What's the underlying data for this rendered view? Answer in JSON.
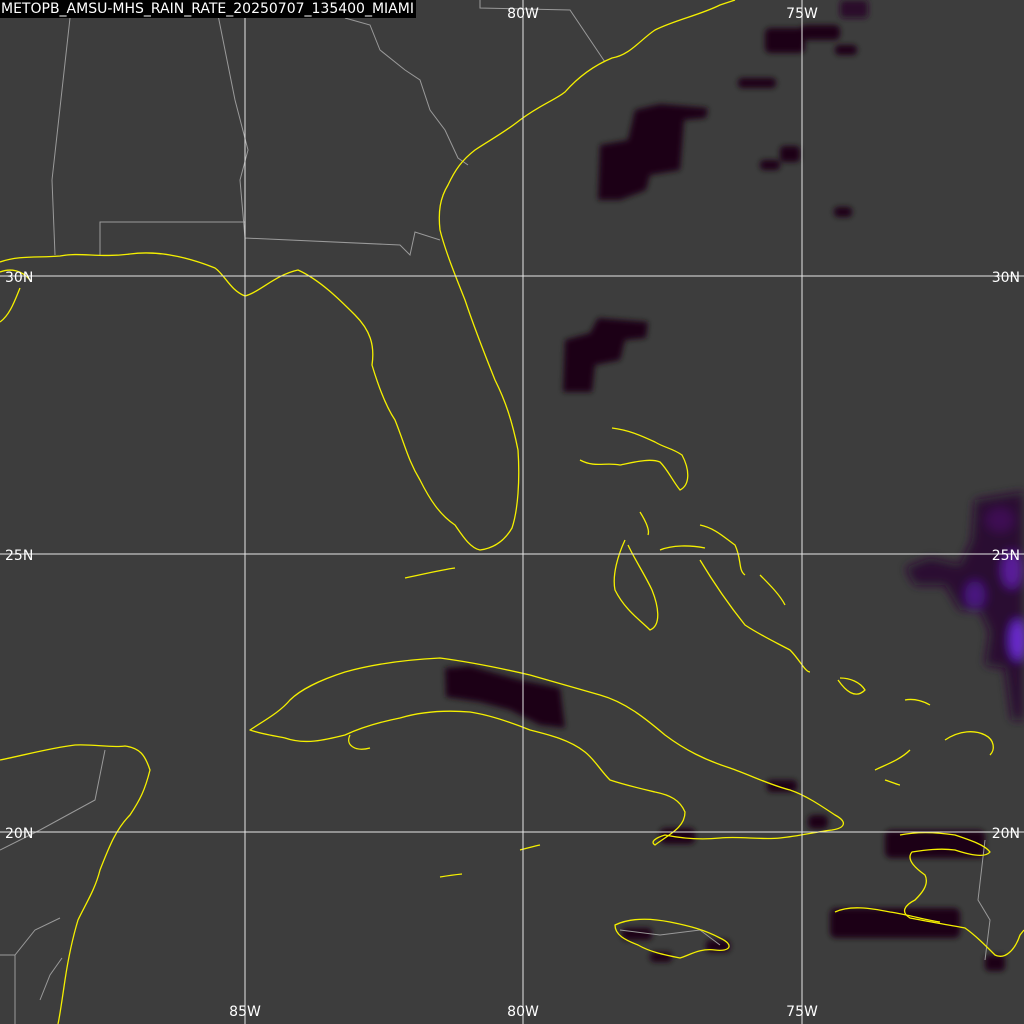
{
  "title": "METOPB_AMSU-MHS_RAIN_RATE_20250707_135400_MIAMI",
  "grid": {
    "lon_labels": [
      "85W",
      "80W",
      "75W"
    ],
    "lat_labels": [
      "30N",
      "25N",
      "20N"
    ],
    "top_lon_labels": [
      "80W",
      "75W"
    ]
  },
  "colors": {
    "background": "#3d3d3d",
    "coastline": "#f5f000",
    "political_borders": "#9a9a9a",
    "gridlines": "#e6e6e6",
    "rain_light": "#1a0618",
    "rain_medium": "#3a0a3c",
    "rain_heavy": "#6a1ea8"
  }
}
